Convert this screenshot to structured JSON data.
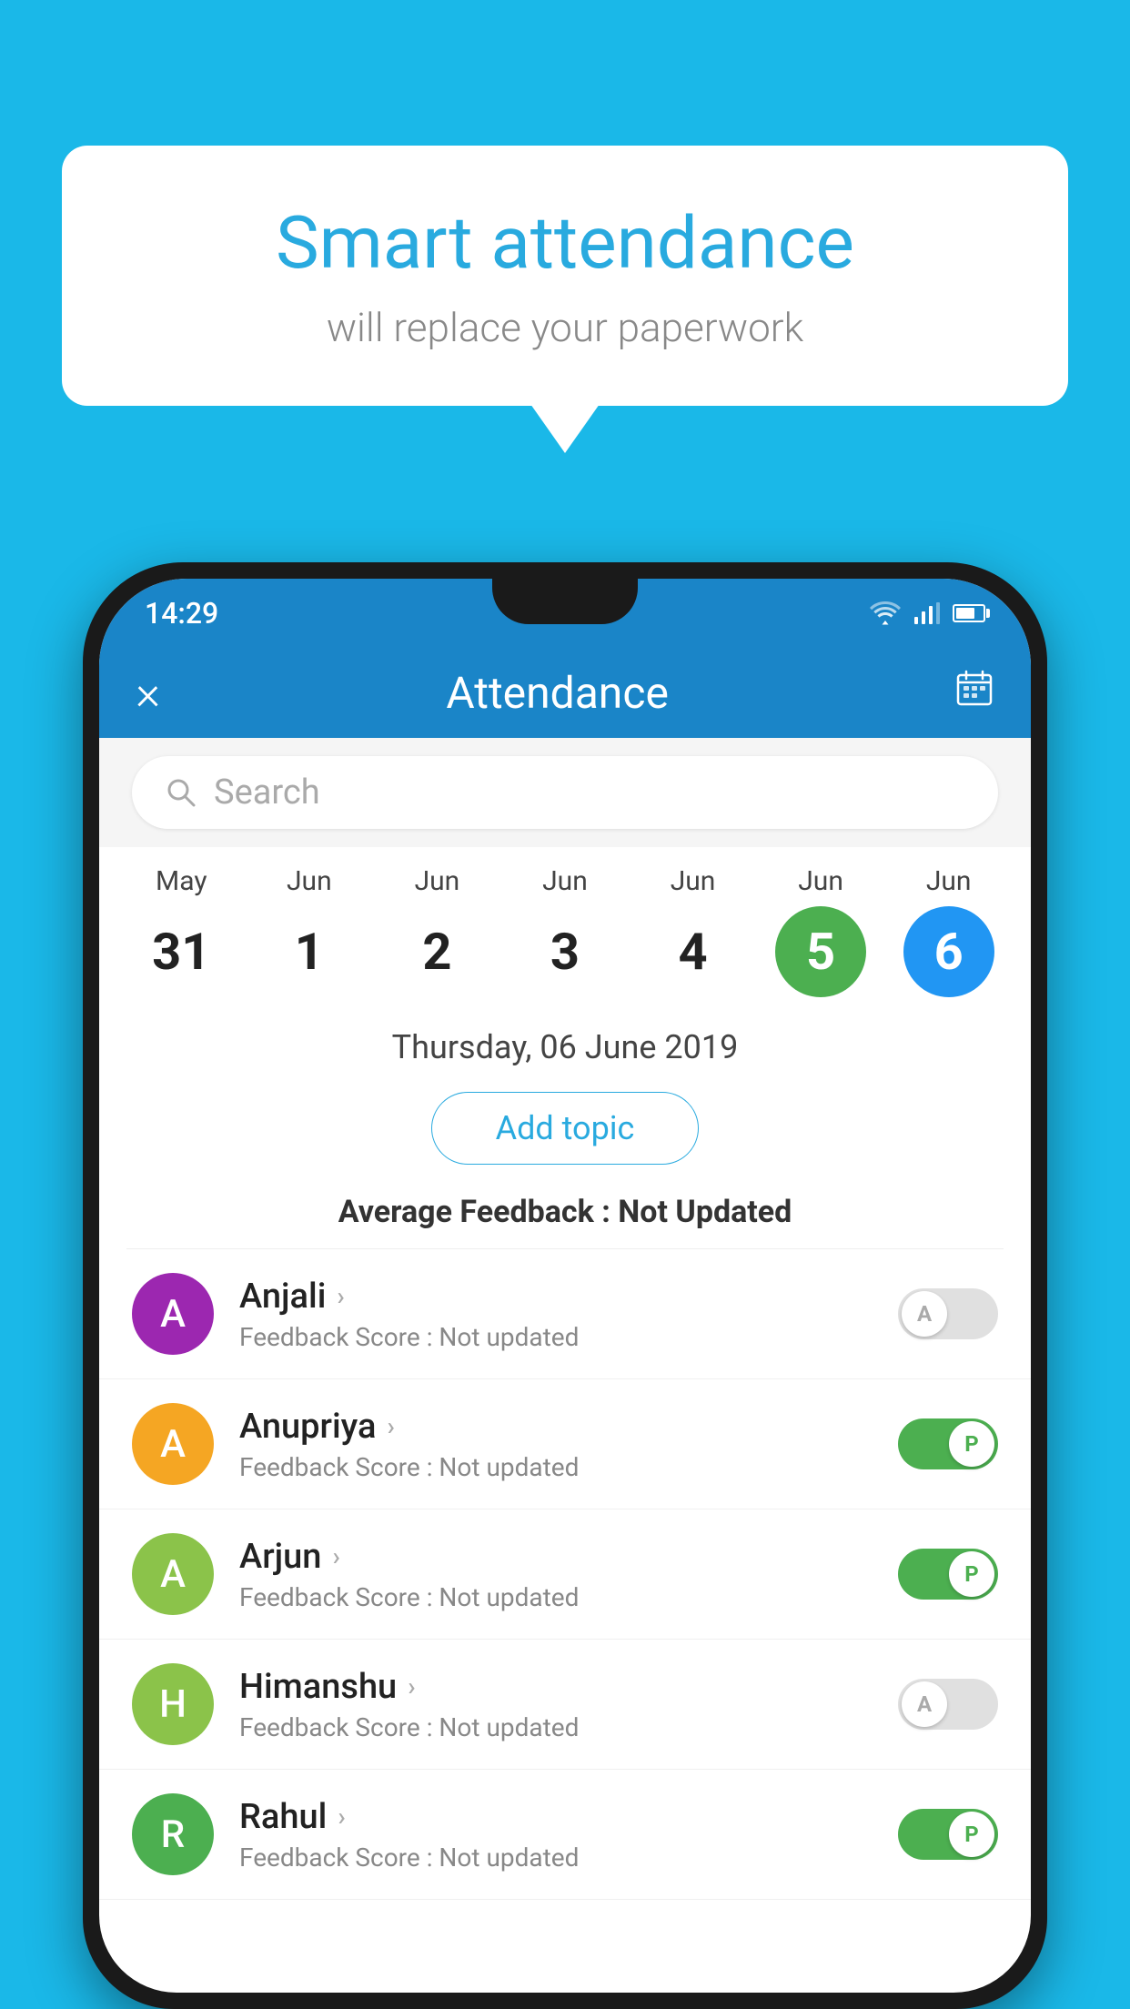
{
  "background": {
    "color": "#1ab8e8"
  },
  "speech_bubble": {
    "title": "Smart attendance",
    "subtitle": "will replace your paperwork"
  },
  "status_bar": {
    "time": "14:29"
  },
  "app_bar": {
    "title": "Attendance",
    "close_icon": "×",
    "calendar_icon": "📅"
  },
  "search": {
    "placeholder": "Search"
  },
  "dates": [
    {
      "month": "May",
      "day": "31",
      "type": "normal"
    },
    {
      "month": "Jun",
      "day": "1",
      "type": "normal"
    },
    {
      "month": "Jun",
      "day": "2",
      "type": "normal"
    },
    {
      "month": "Jun",
      "day": "3",
      "type": "normal"
    },
    {
      "month": "Jun",
      "day": "4",
      "type": "normal"
    },
    {
      "month": "Jun",
      "day": "5",
      "type": "today"
    },
    {
      "month": "Jun",
      "day": "6",
      "type": "selected"
    }
  ],
  "selected_date_label": "Thursday, 06 June 2019",
  "add_topic_label": "Add topic",
  "average_feedback": {
    "label": "Average Feedback : ",
    "value": "Not Updated"
  },
  "students": [
    {
      "name": "Anjali",
      "avatar_letter": "A",
      "avatar_color": "#9c27b0",
      "feedback": "Feedback Score : Not updated",
      "attendance": "absent",
      "toggle_letter": "A"
    },
    {
      "name": "Anupriya",
      "avatar_letter": "A",
      "avatar_color": "#f5a623",
      "feedback": "Feedback Score : Not updated",
      "attendance": "present",
      "toggle_letter": "P"
    },
    {
      "name": "Arjun",
      "avatar_letter": "A",
      "avatar_color": "#8bc34a",
      "feedback": "Feedback Score : Not updated",
      "attendance": "present",
      "toggle_letter": "P"
    },
    {
      "name": "Himanshu",
      "avatar_letter": "H",
      "avatar_color": "#8bc34a",
      "feedback": "Feedback Score : Not updated",
      "attendance": "absent",
      "toggle_letter": "A"
    },
    {
      "name": "Rahul",
      "avatar_letter": "R",
      "avatar_color": "#4caf50",
      "feedback": "Feedback Score : Not updated",
      "attendance": "present",
      "toggle_letter": "P"
    }
  ]
}
